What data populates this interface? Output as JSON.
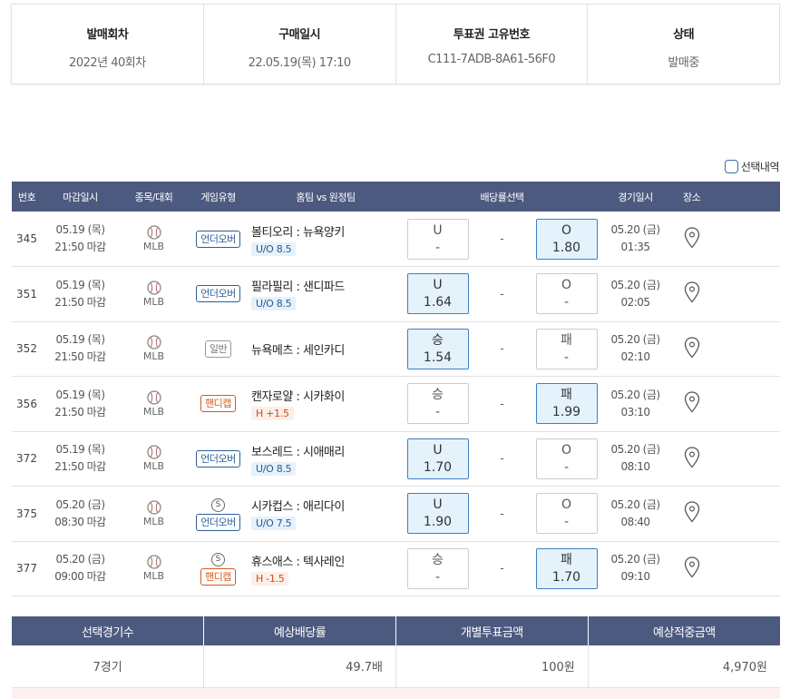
{
  "info": {
    "round_label": "발매회차",
    "round_value": "2022년 40회차",
    "purchase_label": "구매일시",
    "purchase_value": "22.05.19(목) 17:10",
    "ticket_label": "투표권 고유번호",
    "ticket_value": "C111-7ADB-8A61-56F0",
    "status_label": "상태",
    "status_value": "발매중"
  },
  "select_detail_label": "선택내역",
  "headers": {
    "no": "번호",
    "deadline": "마감일시",
    "sport": "종목/대회",
    "game_type": "게임유형",
    "match": "홈팀 vs 원정팀",
    "odds": "배당률선택",
    "game_time": "경기일시",
    "venue": "장소"
  },
  "rows": [
    {
      "no": "345",
      "deadline_date": "05.19 (목)",
      "deadline_time": "21:50 마감",
      "league": "MLB",
      "special": "",
      "type": "언더오버",
      "type_color": "blue",
      "teams": "볼티오리 : 뉴욕양키",
      "handi": "U/O 8.5",
      "handi_kind": "uo",
      "opt1_label": "U",
      "opt1_val": "-",
      "opt1_sel": false,
      "mid": "-",
      "opt2_label": "O",
      "opt2_val": "1.80",
      "opt2_sel": true,
      "game_date": "05.20 (금)",
      "game_time": "01:35"
    },
    {
      "no": "351",
      "deadline_date": "05.19 (목)",
      "deadline_time": "21:50 마감",
      "league": "MLB",
      "special": "",
      "type": "언더오버",
      "type_color": "blue",
      "teams": "필라필리 : 샌디파드",
      "handi": "U/O 8.5",
      "handi_kind": "uo",
      "opt1_label": "U",
      "opt1_val": "1.64",
      "opt1_sel": true,
      "mid": "-",
      "opt2_label": "O",
      "opt2_val": "-",
      "opt2_sel": false,
      "game_date": "05.20 (금)",
      "game_time": "02:05"
    },
    {
      "no": "352",
      "deadline_date": "05.19 (목)",
      "deadline_time": "21:50 마감",
      "league": "MLB",
      "special": "",
      "type": "일반",
      "type_color": "gray",
      "teams": "뉴욕메츠 : 세인카디",
      "handi": "",
      "handi_kind": "",
      "opt1_label": "승",
      "opt1_val": "1.54",
      "opt1_sel": true,
      "mid": "-",
      "opt2_label": "패",
      "opt2_val": "-",
      "opt2_sel": false,
      "game_date": "05.20 (금)",
      "game_time": "02:10"
    },
    {
      "no": "356",
      "deadline_date": "05.19 (목)",
      "deadline_time": "21:50 마감",
      "league": "MLB",
      "special": "",
      "type": "핸디캡",
      "type_color": "red",
      "teams": "캔자로얄 : 시카화이",
      "handi": "H +1.5",
      "handi_kind": "h",
      "opt1_label": "승",
      "opt1_val": "-",
      "opt1_sel": false,
      "mid": "-",
      "opt2_label": "패",
      "opt2_val": "1.99",
      "opt2_sel": true,
      "game_date": "05.20 (금)",
      "game_time": "03:10"
    },
    {
      "no": "372",
      "deadline_date": "05.19 (목)",
      "deadline_time": "21:50 마감",
      "league": "MLB",
      "special": "",
      "type": "언더오버",
      "type_color": "blue",
      "teams": "보스레드 : 시애매리",
      "handi": "U/O 8.5",
      "handi_kind": "uo",
      "opt1_label": "U",
      "opt1_val": "1.70",
      "opt1_sel": true,
      "mid": "-",
      "opt2_label": "O",
      "opt2_val": "-",
      "opt2_sel": false,
      "game_date": "05.20 (금)",
      "game_time": "08:10"
    },
    {
      "no": "375",
      "deadline_date": "05.20 (금)",
      "deadline_time": "08:30 마감",
      "league": "MLB",
      "special": "S",
      "type": "언더오버",
      "type_color": "blue",
      "teams": "시카컵스 : 애리다이",
      "handi": "U/O 7.5",
      "handi_kind": "uo",
      "opt1_label": "U",
      "opt1_val": "1.90",
      "opt1_sel": true,
      "mid": "-",
      "opt2_label": "O",
      "opt2_val": "-",
      "opt2_sel": false,
      "game_date": "05.20 (금)",
      "game_time": "08:40"
    },
    {
      "no": "377",
      "deadline_date": "05.20 (금)",
      "deadline_time": "09:00 마감",
      "league": "MLB",
      "special": "S",
      "type": "핸디캡",
      "type_color": "red",
      "teams": "휴스애스 : 텍사레인",
      "handi": "H -1.5",
      "handi_kind": "h",
      "opt1_label": "승",
      "opt1_val": "-",
      "opt1_sel": false,
      "mid": "-",
      "opt2_label": "패",
      "opt2_val": "1.70",
      "opt2_sel": true,
      "game_date": "05.20 (금)",
      "game_time": "09:10"
    }
  ],
  "summary": {
    "count_label": "선택경기수",
    "odds_label": "예상배당률",
    "amount_label": "개별투표금액",
    "expected_label": "예상적중금액",
    "count_value": "7경기",
    "odds_value": "49.7배",
    "amount_value": "100원",
    "expected_value": "4,970원"
  },
  "icons": {
    "sport": "baseball-icon",
    "venue": "map-pin-icon"
  }
}
